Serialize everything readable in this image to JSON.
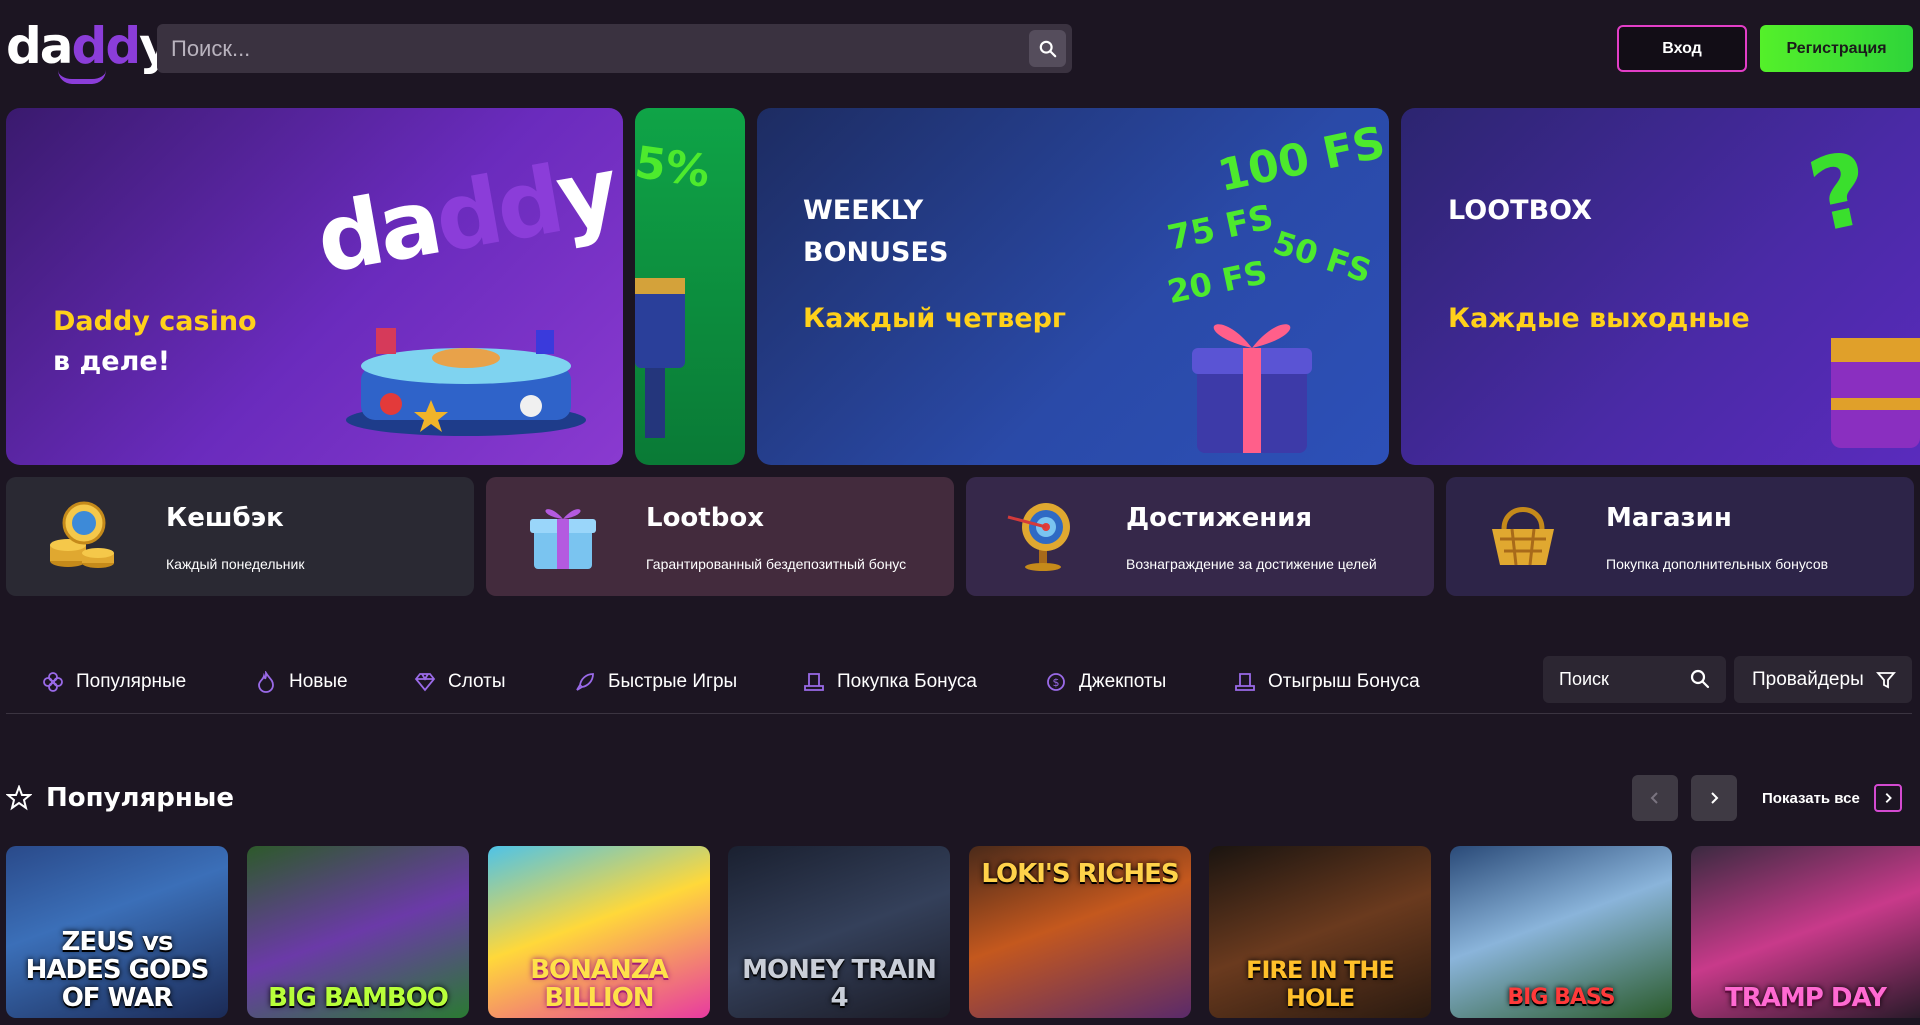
{
  "header": {
    "logo": "daddy",
    "search_placeholder": "Поиск...",
    "login_label": "Вход",
    "register_label": "Регистрация"
  },
  "banners": [
    {
      "line1": "Daddy casino",
      "line2": "в деле!",
      "art_text": "daddy"
    },
    {
      "art_text": "5%"
    },
    {
      "title1": "WEEKLY",
      "title2": "BONUSES",
      "subtitle": "Каждый четверг",
      "fs": [
        "100 FS",
        "75 FS",
        "50 FS",
        "20 FS"
      ]
    },
    {
      "title": "LOOTBOX",
      "subtitle": "Каждые выходные",
      "art_text": "?"
    }
  ],
  "features": [
    {
      "title": "Кешбэк",
      "subtitle": "Каждый понедельник",
      "icon": "coin-stack-icon"
    },
    {
      "title": "Lootbox",
      "subtitle": "Гарантированный бездепозитный бонус",
      "icon": "gift-box-icon"
    },
    {
      "title": "Достижения",
      "subtitle": "Вознаграждение за достижение целей",
      "icon": "target-icon"
    },
    {
      "title": "Магазин",
      "subtitle": "Покупка дополнительных бонусов",
      "icon": "gold-basket-icon"
    }
  ],
  "categories": [
    {
      "label": "Популярные",
      "icon": "clover-icon"
    },
    {
      "label": "Новые",
      "icon": "flame-icon"
    },
    {
      "label": "Слоты",
      "icon": "diamond-icon"
    },
    {
      "label": "Быстрые Игры",
      "icon": "rocket-icon"
    },
    {
      "label": "Покупка Бонуса",
      "icon": "top-hat-icon"
    },
    {
      "label": "Джекпоты",
      "icon": "dollar-badge-icon"
    },
    {
      "label": "Отыгрыш Бонуса",
      "icon": "top-hat-icon"
    }
  ],
  "filters": {
    "search_placeholder": "Поиск",
    "providers_label": "Провайдеры"
  },
  "popular": {
    "title": "Популярные",
    "show_all": "Показать все",
    "games": [
      {
        "name": "ZEUS vs HADES GODS OF WAR"
      },
      {
        "name": "BIG BAMBOO"
      },
      {
        "name": "BONANZA BILLION"
      },
      {
        "name": "MONEY TRAIN 4"
      },
      {
        "name": "LOKI'S RICHES"
      },
      {
        "name": "FIRE IN THE HOLE"
      },
      {
        "name": "BIG BASS"
      },
      {
        "name": "TRAMP DAY"
      }
    ]
  },
  "colors": {
    "background": "#1c1522",
    "accent_purple": "#8b3dd9",
    "accent_pink": "#e23ec7",
    "accent_green": "#54f02a",
    "highlight_yellow": "#ffd11a"
  }
}
